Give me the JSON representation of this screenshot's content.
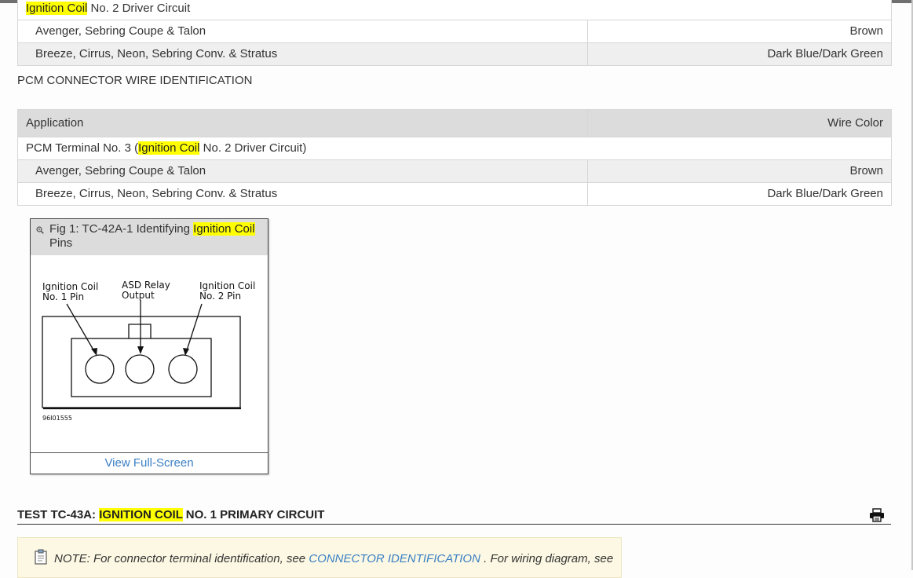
{
  "table1": {
    "group": {
      "hl": "Ignition Coil",
      "rest": " No. 2 Driver Circuit"
    },
    "rows": [
      {
        "app": "Avenger, Sebring Coupe & Talon",
        "color": "Brown"
      },
      {
        "app": "Breeze, Cirrus, Neon, Sebring Conv. & Stratus",
        "color": "Dark Blue/Dark Green"
      }
    ]
  },
  "section_label": "PCM CONNECTOR WIRE IDENTIFICATION",
  "table2": {
    "headers": {
      "application": "Application",
      "wire_color": "Wire Color"
    },
    "group": {
      "pre": "PCM Terminal No. 3 (",
      "hl": "Ignition Coil",
      "post": " No. 2 Driver Circuit)"
    },
    "rows": [
      {
        "app": "Avenger, Sebring Coupe & Talon",
        "color": "Brown"
      },
      {
        "app": "Breeze, Cirrus, Neon, Sebring Conv. & Stratus",
        "color": "Dark Blue/Dark Green"
      }
    ]
  },
  "figure": {
    "title_pre": "Fig 1: TC-42A-1 Identifying ",
    "title_hl": "Ignition Coil",
    "title_post": " Pins",
    "labels": {
      "coil1_line1": "Ignition Coil",
      "coil1_line2": "No. 1 Pin",
      "asd_line1": "ASD Relay",
      "asd_line2": "Output",
      "coil2_line1": "Ignition Coil",
      "coil2_line2": "No. 2 Pin",
      "code": "96I01555"
    },
    "view_full": "View Full-Screen"
  },
  "test": {
    "pre": "TEST TC-43A: ",
    "hl": "IGNITION COIL",
    "post": " NO. 1 PRIMARY CIRCUIT"
  },
  "note": {
    "pre": "NOTE: For connector terminal identification, see ",
    "link": "CONNECTOR IDENTIFICATION",
    "post": " . For wiring diagram, see"
  },
  "colors": {
    "highlight": "#ffff00",
    "link": "#3a7fc4"
  }
}
